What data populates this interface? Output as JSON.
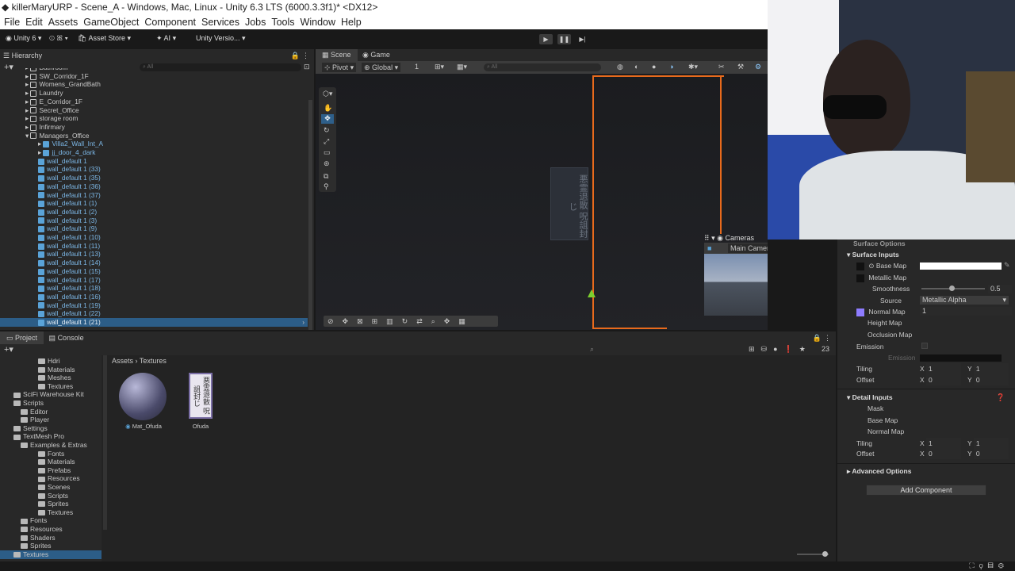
{
  "window": {
    "title": "killerMaryURP - Scene_A - Windows, Mac, Linux - Unity 6.3 LTS (6000.3.3f1)* <DX12>"
  },
  "menu": [
    "File",
    "Edit",
    "Assets",
    "GameObject",
    "Component",
    "Services",
    "Jobs",
    "Tools",
    "Window",
    "Help"
  ],
  "toolbar": {
    "unity": "Unity 6",
    "account": "ꕤ",
    "asset_store": "Asset Store",
    "ai": "AI",
    "version": "Unity Versio..."
  },
  "hierarchy": {
    "tab": "Hierarchy",
    "search_placeholder": "All",
    "rows": [
      {
        "label": "Bathroom",
        "type": "obj",
        "indent": 0
      },
      {
        "label": "SW_Corridor_1F",
        "type": "obj",
        "indent": 0
      },
      {
        "label": "Womens_GrandBath",
        "type": "obj",
        "indent": 0
      },
      {
        "label": "Laundry",
        "type": "obj",
        "indent": 0
      },
      {
        "label": "E_Corridor_1F",
        "type": "obj",
        "indent": 0
      },
      {
        "label": "Secret_Office",
        "type": "obj",
        "indent": 0
      },
      {
        "label": "storage room",
        "type": "obj",
        "indent": 0
      },
      {
        "label": "Infirmary",
        "type": "obj",
        "indent": 0
      },
      {
        "label": "Managers_Office",
        "type": "obj",
        "indent": 0
      },
      {
        "label": "Villa2_Wall_Int_A",
        "type": "prefab",
        "indent": 1
      },
      {
        "label": "jj_door_4_dark",
        "type": "prefab",
        "indent": 1
      },
      {
        "label": "wall_default 1",
        "type": "prefab",
        "indent": 1
      },
      {
        "label": "wall_default 1 (33)",
        "type": "prefab",
        "indent": 1
      },
      {
        "label": "wall_default 1 (35)",
        "type": "prefab",
        "indent": 1
      },
      {
        "label": "wall_default 1 (36)",
        "type": "prefab",
        "indent": 1
      },
      {
        "label": "wall_default 1 (37)",
        "type": "prefab",
        "indent": 1
      },
      {
        "label": "wall_default 1 (1)",
        "type": "prefab",
        "indent": 1
      },
      {
        "label": "wall_default 1 (2)",
        "type": "prefab",
        "indent": 1
      },
      {
        "label": "wall_default 1 (3)",
        "type": "prefab",
        "indent": 1
      },
      {
        "label": "wall_default 1 (9)",
        "type": "prefab",
        "indent": 1
      },
      {
        "label": "wall_default 1 (10)",
        "type": "prefab",
        "indent": 1
      },
      {
        "label": "wall_default 1 (11)",
        "type": "prefab",
        "indent": 1
      },
      {
        "label": "wall_default 1 (13)",
        "type": "prefab",
        "indent": 1
      },
      {
        "label": "wall_default 1 (14)",
        "type": "prefab",
        "indent": 1
      },
      {
        "label": "wall_default 1 (15)",
        "type": "prefab",
        "indent": 1
      },
      {
        "label": "wall_default 1 (17)",
        "type": "prefab",
        "indent": 1
      },
      {
        "label": "wall_default 1 (18)",
        "type": "prefab",
        "indent": 1
      },
      {
        "label": "wall_default 1 (16)",
        "type": "prefab",
        "indent": 1
      },
      {
        "label": "wall_default 1 (19)",
        "type": "prefab",
        "indent": 1
      },
      {
        "label": "wall_default 1 (22)",
        "type": "prefab",
        "indent": 1
      },
      {
        "label": "wall_default 1 (21)",
        "type": "prefab",
        "indent": 1
      }
    ]
  },
  "scene": {
    "tab_scene": "Scene",
    "tab_game": "Game",
    "pivot": "Pivot",
    "global": "Global",
    "grid_value": "1",
    "search_placeholder": "All",
    "sign_text": "悪霊退散 呪詛封じ",
    "cameras": {
      "title": "Cameras",
      "camera": "Main Camera"
    }
  },
  "project": {
    "tab_project": "Project",
    "tab_console": "Console",
    "breadcrumb": [
      "Assets",
      "Textures"
    ],
    "count": "23",
    "tree": [
      {
        "label": "Hdri",
        "indent": 3
      },
      {
        "label": "Materials",
        "indent": 3
      },
      {
        "label": "Meshes",
        "indent": 3
      },
      {
        "label": "Textures",
        "indent": 3
      },
      {
        "label": "SciFi Warehouse Kit",
        "indent": 1
      },
      {
        "label": "Scripts",
        "indent": 1
      },
      {
        "label": "Editor",
        "indent": 2
      },
      {
        "label": "Player",
        "indent": 2
      },
      {
        "label": "Settings",
        "indent": 1
      },
      {
        "label": "TextMesh Pro",
        "indent": 1
      },
      {
        "label": "Examples & Extras",
        "indent": 2
      },
      {
        "label": "Fonts",
        "indent": 3
      },
      {
        "label": "Materials",
        "indent": 3
      },
      {
        "label": "Prefabs",
        "indent": 3
      },
      {
        "label": "Resources",
        "indent": 3
      },
      {
        "label": "Scenes",
        "indent": 3
      },
      {
        "label": "Scripts",
        "indent": 3
      },
      {
        "label": "Sprites",
        "indent": 3
      },
      {
        "label": "Textures",
        "indent": 3
      },
      {
        "label": "Fonts",
        "indent": 2
      },
      {
        "label": "Resources",
        "indent": 2
      },
      {
        "label": "Shaders",
        "indent": 2
      },
      {
        "label": "Sprites",
        "indent": 2
      },
      {
        "label": "Textures",
        "indent": 1
      }
    ],
    "assets": [
      {
        "name": "Mat_Ofuda"
      },
      {
        "name": "Ofuda"
      }
    ]
  },
  "inspector": {
    "surface_options": "Surface Options",
    "surface_inputs": "Surface Inputs",
    "base_map": "Base Map",
    "metallic_map": "Metallic Map",
    "smoothness": "Smoothness",
    "smoothness_value": "0.5",
    "source": "Source",
    "source_value": "Metallic Alpha",
    "normal_map": "Normal Map",
    "normal_value": "1",
    "height_map": "Height Map",
    "occlusion_map": "Occlusion Map",
    "emission": "Emission",
    "emission_map": "Emission",
    "tiling": "Tiling",
    "offset": "Offset",
    "tiling_x": "1",
    "tiling_y": "1",
    "offset_x": "0",
    "offset_y": "0",
    "detail_inputs": "Detail Inputs",
    "mask": "Mask",
    "detail_base_map": "Base Map",
    "detail_normal_map": "Normal Map",
    "d_tiling_x": "1",
    "d_tiling_y": "1",
    "d_offset_x": "0",
    "d_offset_y": "0",
    "advanced": "Advanced Options",
    "add_component": "Add Component",
    "x": "X",
    "y": "Y"
  }
}
